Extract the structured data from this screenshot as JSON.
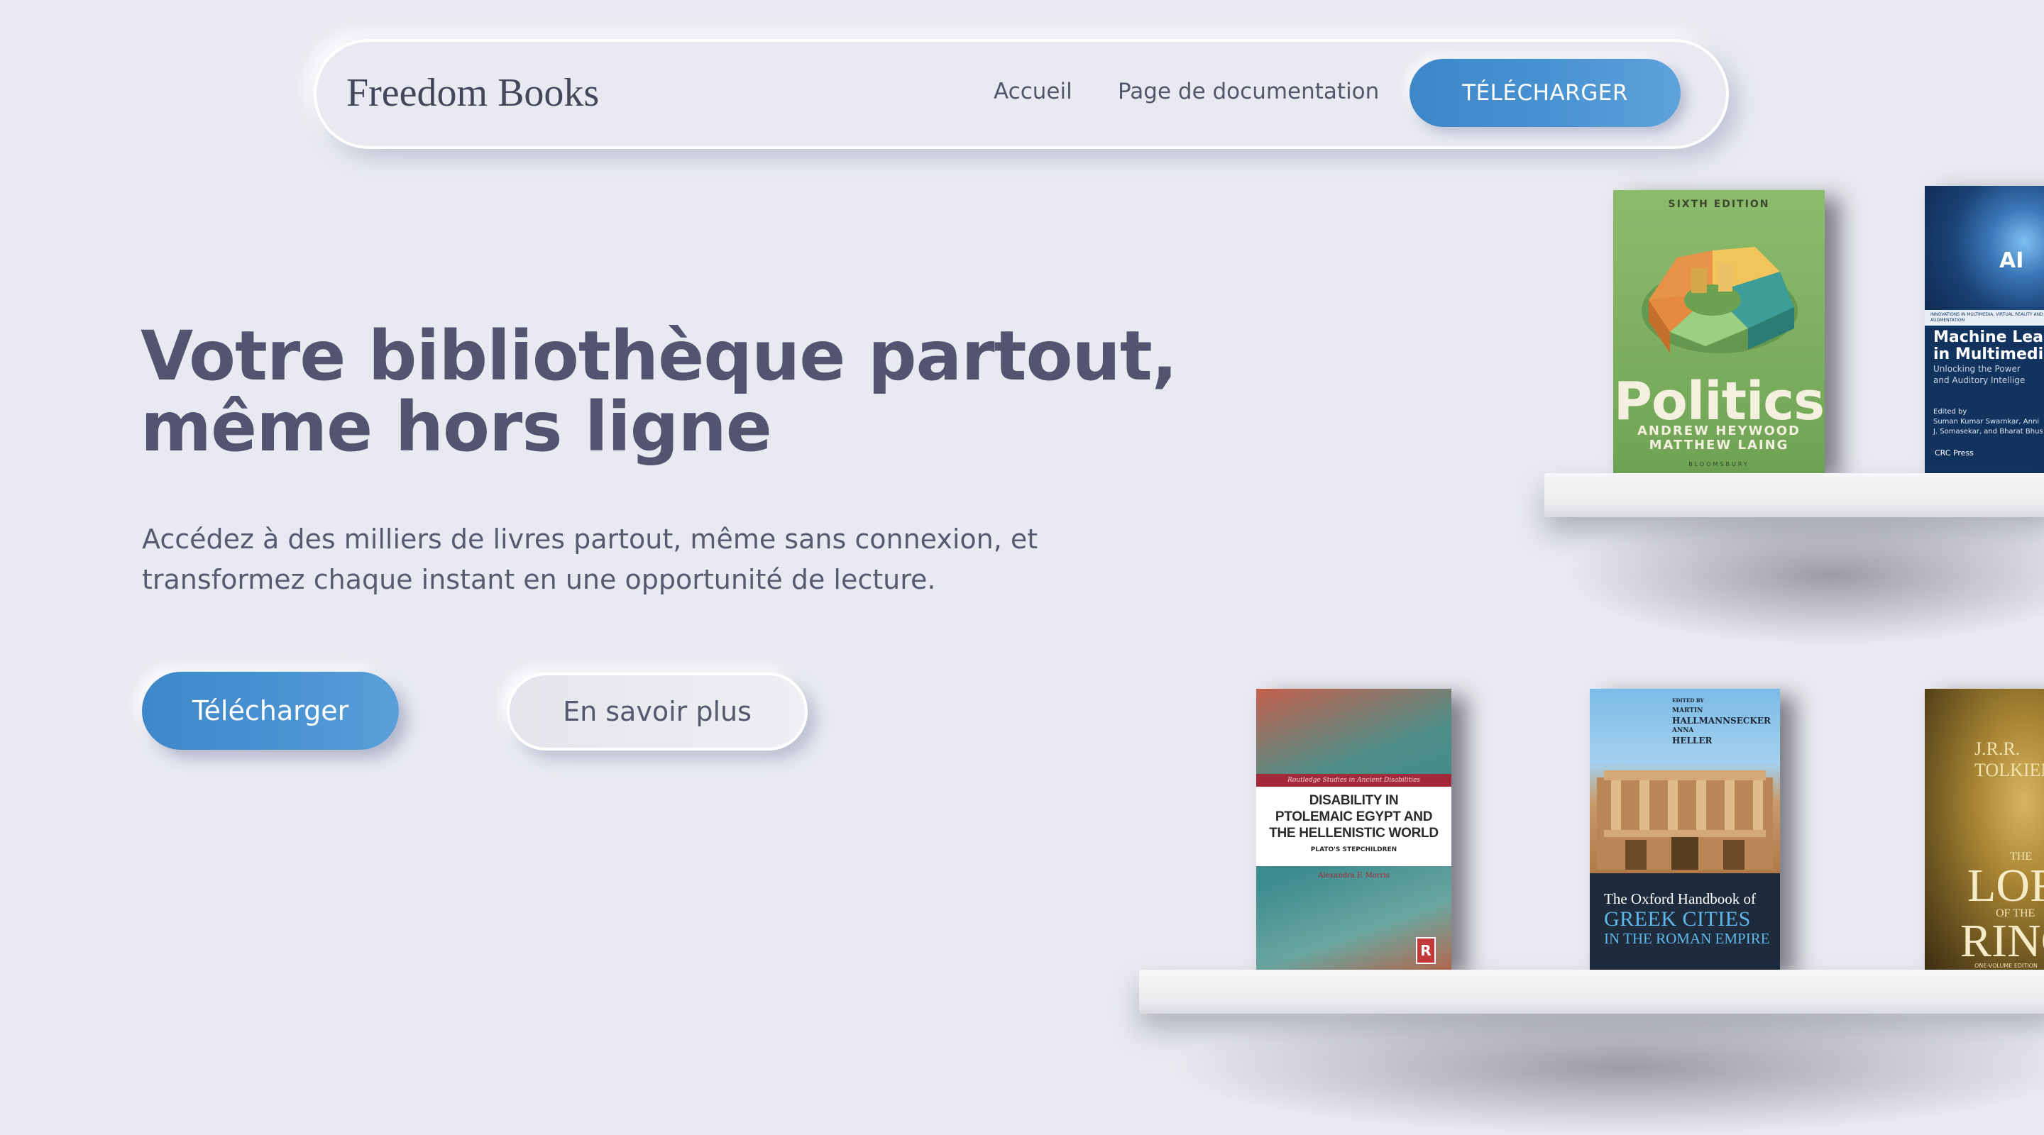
{
  "navbar": {
    "brand": "Freedom Books",
    "links": [
      {
        "label": "Accueil"
      },
      {
        "label": "Page de documentation"
      }
    ],
    "download_label": "TÉLÉCHARGER"
  },
  "hero": {
    "title_lines": [
      "Votre bibliothèque partout,",
      "même hors ligne"
    ],
    "subtitle_lines": [
      "Accédez à des milliers de livres partout, même sans connexion, et",
      "transformez chaque instant en une opportunité de lecture."
    ],
    "primary_button": "Télécharger",
    "secondary_button": "En savoir plus"
  },
  "books": {
    "politics": {
      "edition": "SIXTH EDITION",
      "title": "Politics",
      "authors": [
        "ANDREW HEYWOOD",
        "MATTHEW LAING"
      ],
      "publisher": "BLOOMSBURY"
    },
    "machine_learning": {
      "badge": "AI",
      "series": "INNOVATIONS IN MULTIMEDIA, VIRTUAL REALITY AND AUGMENTATION",
      "title_lines": [
        "Machine Lear",
        "in Multimedia"
      ],
      "subtitle_lines": [
        "Unlocking the Power",
        "and Auditory Intellige"
      ],
      "editors_lines": [
        "Edited by",
        "Suman Kumar Swarnkar, Anni",
        "J. Somasekar, and Bharat Bhus"
      ],
      "publisher": "CRC Press"
    },
    "disability": {
      "series": "Routledge Studies in Ancient Disabilities",
      "title_lines": [
        "DISABILITY IN",
        "PTOLEMAIC EGYPT AND",
        "THE HELLENISTIC WORLD"
      ],
      "subtitle": "PLATO'S STEPCHILDREN",
      "author": "Alexandra F. Morris",
      "publisher_mark": "R"
    },
    "greek_cities": {
      "editors_lines": [
        "EDITED BY",
        "MARTIN",
        "HALLMANNSECKER",
        "ANNA",
        "HELLER"
      ],
      "title_line1": "The Oxford Handbook of",
      "title_line2": "GREEK CITIES",
      "title_line3": "IN THE ROMAN EMPIRE"
    },
    "lotr": {
      "author_lines": [
        "J.R.R.",
        "TOLKIEN"
      ],
      "the": "THE",
      "lord": "LORD",
      "of_the": "OF THE",
      "rings": "RINGS",
      "edition": "ONE-VOLUME EDITION"
    }
  },
  "colors": {
    "background": "#e9eaf1",
    "accent_blue": "#4a93d2",
    "heading": "#525470",
    "body_text": "#585b70"
  }
}
